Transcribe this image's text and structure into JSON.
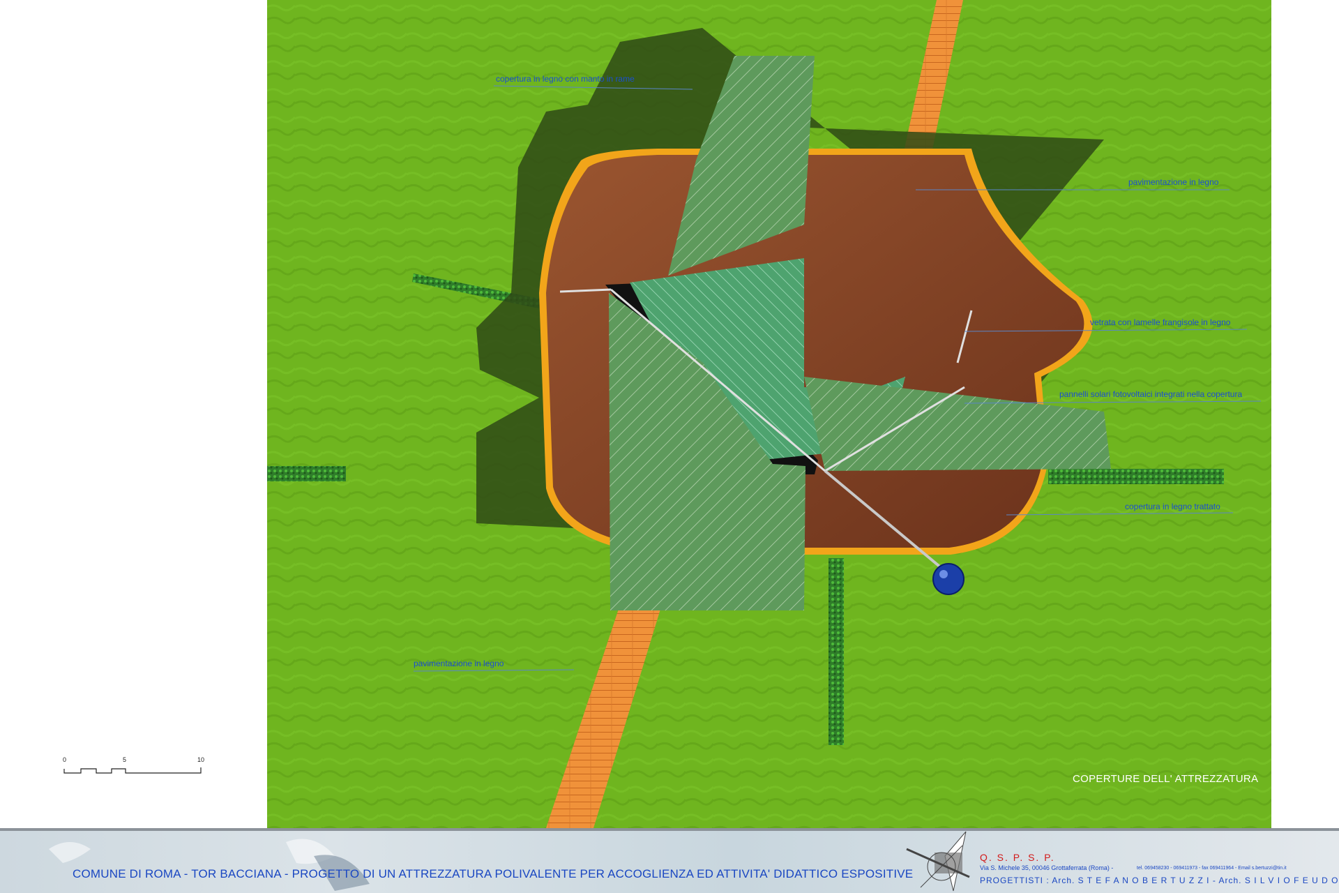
{
  "plan": {
    "labels": [
      {
        "key": "copper_roof",
        "text": "copertura in legno con manto in rame"
      },
      {
        "key": "wood_paving_top",
        "text": "pavimentazione in legno"
      },
      {
        "key": "glazing",
        "text": "vetrata con lamelle frangisole in legno"
      },
      {
        "key": "solar_panels",
        "text": "pannelli solari fotovoltaici integrati nella copertura"
      },
      {
        "key": "treated_wood_roof",
        "text": "copertura in legno trattato"
      },
      {
        "key": "wood_paving_bottom",
        "text": "pavimentazione in legno"
      }
    ],
    "sheet_title": "COPERTURE DELL' ATTREZZATURA"
  },
  "scale": {
    "ticks": [
      "0",
      "5",
      "10"
    ]
  },
  "footer": {
    "project_title": "COMUNE DI ROMA - TOR BACCIANA - PROGETTO DI UN ATTREZZATURA POLIVALENTE PER ACCOGLIENZA ED ATTIVITA' DIDATTICO ESPOSITIVE",
    "firm_name": "Q. S. P. S. P.",
    "firm_address": "Via S. Michele 35, 00046 Grottaferrata (Roma) -",
    "firm_contacts": "tel. 069458230 - 069411973 - fax 069411964 - Email s.bertuzzi@tin.it",
    "designers": "PROGETTISTI :  Arch. S T E F A N O   B E R T U Z Z I   -  Arch. S I L V I O   F E U D O"
  },
  "colors": {
    "grass": "#6fb51f",
    "roof_green": "#5e9a5c",
    "wood": "#7b3d22",
    "orange_rim": "#f2a51a",
    "label_blue": "#1a4fd0"
  }
}
